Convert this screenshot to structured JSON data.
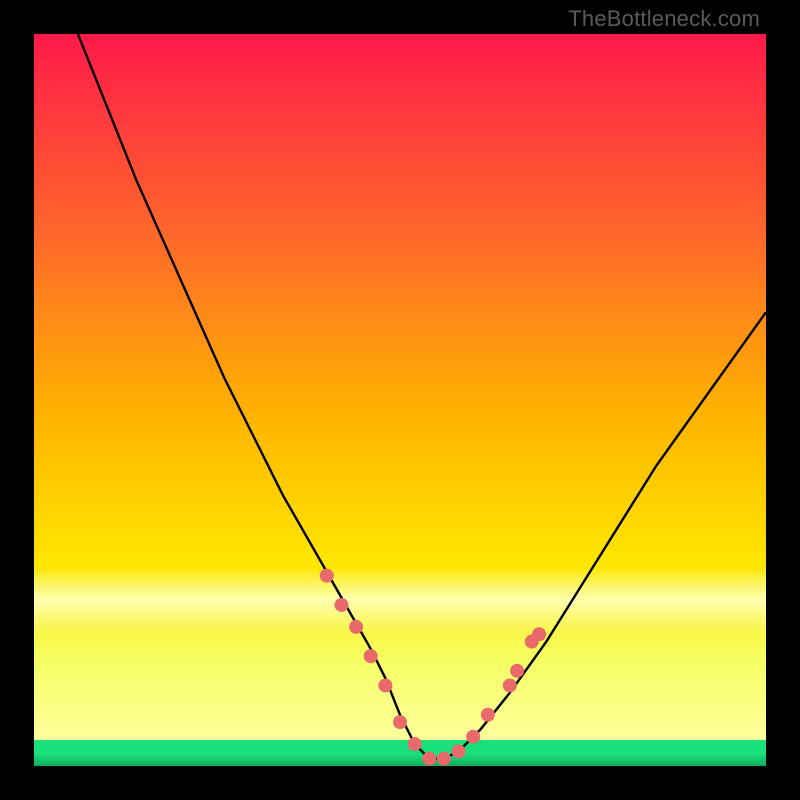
{
  "attribution": "TheBottleneck.com",
  "colors": {
    "black": "#000000",
    "grad_top": "#ff1a4a",
    "grad_mid1": "#ff6a2a",
    "grad_mid2": "#ffb400",
    "grad_mid3": "#ffe600",
    "grad_low": "#f6ff66",
    "glow": "#ffffb0",
    "green": "#19e07a",
    "curve": "#000000",
    "marker": "#e86a6a"
  },
  "chart_data": {
    "type": "line",
    "title": "",
    "xlabel": "",
    "ylabel": "",
    "xlim": [
      0,
      100
    ],
    "ylim": [
      0,
      100
    ],
    "series": [
      {
        "name": "bottleneck-curve",
        "x": [
          6,
          10,
          14,
          18,
          22,
          26,
          30,
          34,
          38,
          42,
          46,
          48,
          50,
          52,
          54,
          56,
          58,
          61,
          65,
          70,
          75,
          80,
          85,
          90,
          95,
          100
        ],
        "y": [
          100,
          90,
          80,
          71,
          62,
          53,
          45,
          37,
          30,
          23,
          16,
          12,
          7,
          3,
          1,
          1,
          2,
          5,
          10,
          17,
          25,
          33,
          41,
          48,
          55,
          62
        ]
      }
    ],
    "markers": {
      "name": "highlighted-points",
      "x": [
        40,
        42,
        44,
        46,
        48,
        50,
        52,
        54,
        56,
        58,
        60,
        62,
        65,
        66,
        68,
        69
      ],
      "y": [
        26,
        22,
        19,
        15,
        11,
        6,
        3,
        1,
        1,
        2,
        4,
        7,
        11,
        13,
        17,
        18
      ]
    },
    "bands": [
      {
        "name": "yellow-glow",
        "y0": 18,
        "y1": 27
      },
      {
        "name": "green-floor",
        "y0": 0,
        "y1": 3.5
      }
    ]
  }
}
